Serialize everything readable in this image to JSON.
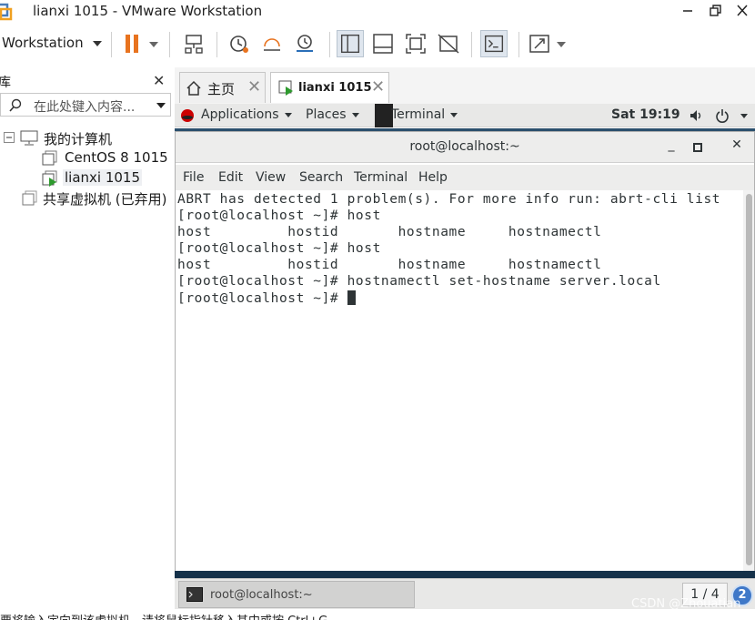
{
  "window": {
    "title": "lianxi 1015 - VMware Workstation"
  },
  "toolbar": {
    "workstation_menu": "Workstation",
    "icons": [
      "pause-icon",
      "send-ctrl-alt-del-icon",
      "snapshot-icon",
      "revert-snapshot-icon",
      "manage-snapshots-icon",
      "library-view-icon",
      "console-view-icon",
      "fullscreen-icon",
      "unity-icon",
      "terminal-icon",
      "stretch-icon"
    ]
  },
  "library": {
    "title": "库",
    "search_placeholder": "在此处键入内容...",
    "tree": {
      "root": "我的计算机",
      "vms": [
        "CentOS 8 1015",
        "lianxi 1015"
      ],
      "shared": "共享虚拟机 (已弃用)"
    }
  },
  "tabs": [
    {
      "label": "主页"
    },
    {
      "label": "lianxi 1015"
    }
  ],
  "gnome": {
    "applications": "Applications",
    "places": "Places",
    "terminal": "Terminal",
    "clock": "Sat 19:19"
  },
  "terminal": {
    "title": "root@localhost:~",
    "menu": [
      "File",
      "Edit",
      "View",
      "Search",
      "Terminal",
      "Help"
    ],
    "lines": [
      "ABRT has detected 1 problem(s). For more info run: abrt-cli list",
      "[root@localhost ~]# host",
      "host         hostid       hostname     hostnamectl",
      "[root@localhost ~]# host",
      "host         hostid       hostname     hostnamectl",
      "[root@localhost ~]# hostnamectl set-hostname server.local",
      "[root@localhost ~]# "
    ]
  },
  "taskbar": {
    "task_label": "root@localhost:~",
    "workspace": "1 / 4",
    "badge": "2"
  },
  "status": {
    "text": "要将输入定向到该虚拟机，请将鼠标指针移入其中或按 Ctrl+G。"
  },
  "watermark": "CSDN @Zhouatian"
}
